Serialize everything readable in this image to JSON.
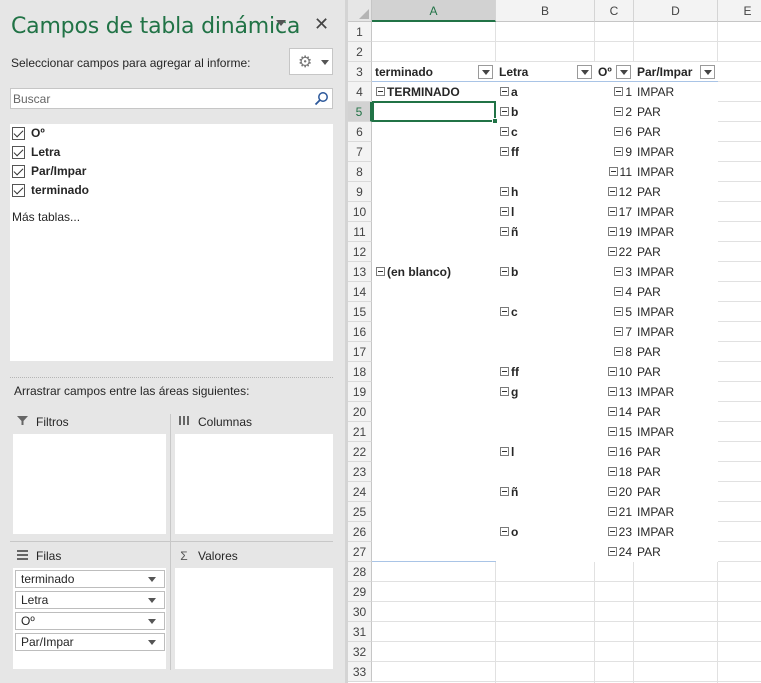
{
  "pane": {
    "title": "Campos de tabla dinámica",
    "select_label": "Seleccionar campos para agregar al informe:",
    "search_placeholder": "Buscar",
    "fields": [
      {
        "label": "Oº",
        "checked": true
      },
      {
        "label": "Letra",
        "checked": true
      },
      {
        "label": "Par/Impar",
        "checked": true
      },
      {
        "label": "terminado",
        "checked": true
      }
    ],
    "more_tables": "Más tablas...",
    "drag_label": "Arrastrar campos entre las áreas siguientes:",
    "areas": {
      "filters": "Filtros",
      "columns": "Columnas",
      "rows": "Filas",
      "values": "Valores"
    },
    "row_fields": [
      "terminado",
      "Letra",
      "Oº",
      "Par/Impar"
    ]
  },
  "sheet": {
    "columns": [
      "A",
      "B",
      "C",
      "D",
      "E"
    ],
    "selected_cell": "A5",
    "row_numbers": [
      "1",
      "2",
      "3",
      "4",
      "5",
      "6",
      "7",
      "8",
      "9",
      "10",
      "11",
      "12",
      "13",
      "14",
      "15",
      "16",
      "17",
      "18",
      "19",
      "20",
      "21",
      "22",
      "23",
      "24",
      "25",
      "26",
      "27",
      "28",
      "29",
      "30",
      "31",
      "32",
      "33"
    ],
    "pivot_headers": [
      "terminado",
      "Letra",
      "Oº",
      "Par/Impar"
    ],
    "pivot_rows": [
      {
        "a": "TERMINADO",
        "b": "a",
        "c": "1",
        "d": "IMPAR"
      },
      {
        "a": "",
        "b": "b",
        "c": "2",
        "d": "PAR"
      },
      {
        "a": "",
        "b": "c",
        "c": "6",
        "d": "PAR"
      },
      {
        "a": "",
        "b": "ff",
        "c": "9",
        "d": "IMPAR"
      },
      {
        "a": "",
        "b": "",
        "c": "11",
        "d": "IMPAR"
      },
      {
        "a": "",
        "b": "h",
        "c": "12",
        "d": "PAR"
      },
      {
        "a": "",
        "b": "l",
        "c": "17",
        "d": "IMPAR"
      },
      {
        "a": "",
        "b": "ñ",
        "c": "19",
        "d": "IMPAR"
      },
      {
        "a": "",
        "b": "",
        "c": "22",
        "d": "PAR"
      },
      {
        "a": "(en blanco)",
        "b": "b",
        "c": "3",
        "d": "IMPAR"
      },
      {
        "a": "",
        "b": "",
        "c": "4",
        "d": "PAR"
      },
      {
        "a": "",
        "b": "c",
        "c": "5",
        "d": "IMPAR"
      },
      {
        "a": "",
        "b": "",
        "c": "7",
        "d": "IMPAR"
      },
      {
        "a": "",
        "b": "",
        "c": "8",
        "d": "PAR"
      },
      {
        "a": "",
        "b": "ff",
        "c": "10",
        "d": "PAR"
      },
      {
        "a": "",
        "b": "g",
        "c": "13",
        "d": "IMPAR"
      },
      {
        "a": "",
        "b": "",
        "c": "14",
        "d": "PAR"
      },
      {
        "a": "",
        "b": "",
        "c": "15",
        "d": "IMPAR"
      },
      {
        "a": "",
        "b": "l",
        "c": "16",
        "d": "PAR"
      },
      {
        "a": "",
        "b": "",
        "c": "18",
        "d": "PAR"
      },
      {
        "a": "",
        "b": "ñ",
        "c": "20",
        "d": "PAR"
      },
      {
        "a": "",
        "b": "",
        "c": "21",
        "d": "IMPAR"
      },
      {
        "a": "",
        "b": "o",
        "c": "23",
        "d": "IMPAR"
      },
      {
        "a": "",
        "b": "",
        "c": "24",
        "d": "PAR"
      }
    ]
  }
}
